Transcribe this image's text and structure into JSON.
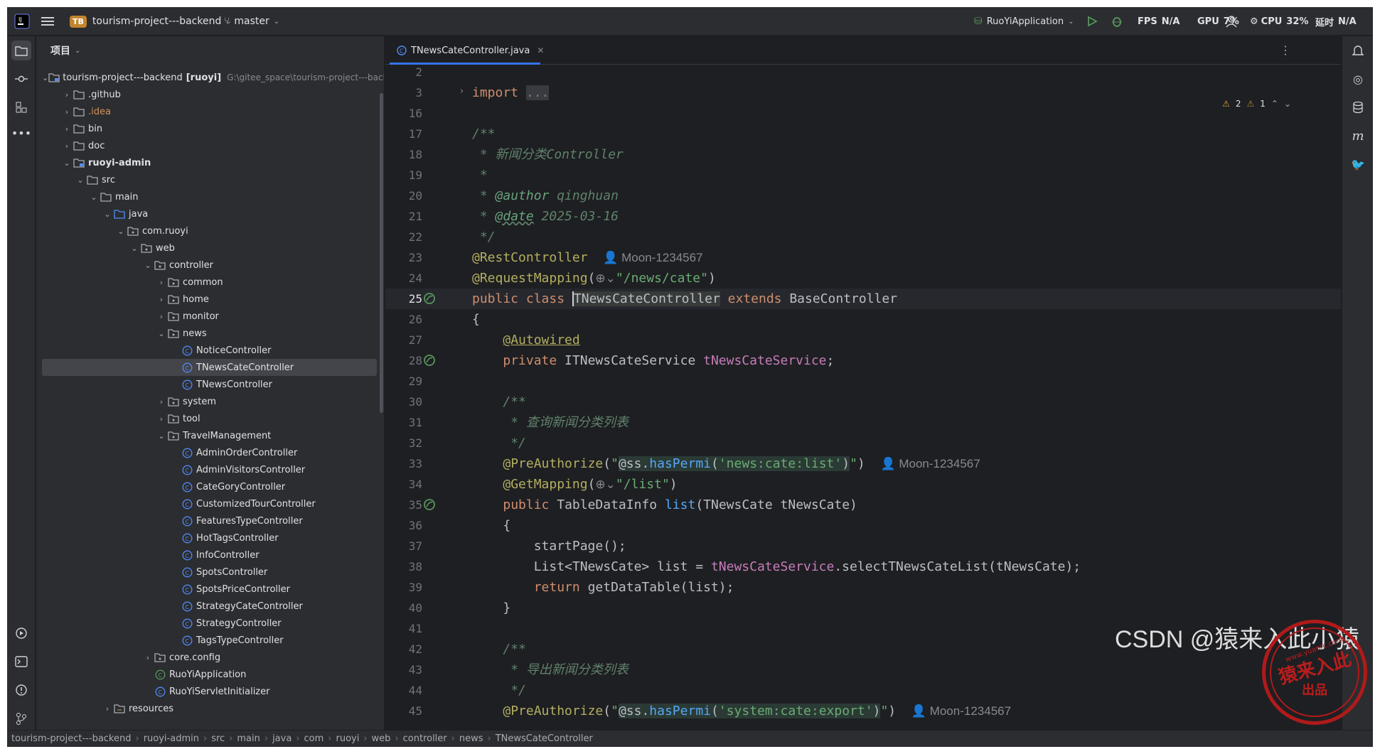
{
  "titlebar": {
    "project_badge": "TB",
    "project_name": "tourism-project---backend",
    "branch": "master",
    "run_config": "RuoYiApplication",
    "fps_label": "FPS",
    "fps_value": "N/A",
    "gpu_label": "GPU",
    "gpu_value": "7%",
    "cpu_label": "CPU",
    "cpu_value": "32%",
    "delay_label": "延时",
    "delay_value": "N/A"
  },
  "project_panel": {
    "title": "项目",
    "tree": [
      {
        "label": "tourism-project---backend",
        "suffix": "[ruoyi]",
        "path": "G:\\gitee_space\\tourism-project---back",
        "depth": 0,
        "open": true,
        "type": "module"
      },
      {
        "label": ".github",
        "depth": 1,
        "open": false,
        "type": "folder"
      },
      {
        "label": ".idea",
        "depth": 1,
        "open": false,
        "type": "folder",
        "color": "#d5935a"
      },
      {
        "label": "bin",
        "depth": 1,
        "open": false,
        "type": "folder"
      },
      {
        "label": "doc",
        "depth": 1,
        "open": false,
        "type": "folder"
      },
      {
        "label": "ruoyi-admin",
        "depth": 1,
        "open": true,
        "type": "module",
        "bold": true
      },
      {
        "label": "src",
        "depth": 2,
        "open": true,
        "type": "folder"
      },
      {
        "label": "main",
        "depth": 3,
        "open": true,
        "type": "folder"
      },
      {
        "label": "java",
        "depth": 4,
        "open": true,
        "type": "srcfolder"
      },
      {
        "label": "com.ruoyi",
        "depth": 5,
        "open": true,
        "type": "package"
      },
      {
        "label": "web",
        "depth": 6,
        "open": true,
        "type": "package"
      },
      {
        "label": "controller",
        "depth": 7,
        "open": true,
        "type": "package"
      },
      {
        "label": "common",
        "depth": 8,
        "open": false,
        "type": "package"
      },
      {
        "label": "home",
        "depth": 8,
        "open": false,
        "type": "package"
      },
      {
        "label": "monitor",
        "depth": 8,
        "open": false,
        "type": "package"
      },
      {
        "label": "news",
        "depth": 8,
        "open": true,
        "type": "package"
      },
      {
        "label": "NoticeController",
        "depth": 9,
        "type": "class"
      },
      {
        "label": "TNewsCateController",
        "depth": 9,
        "type": "class",
        "selected": true
      },
      {
        "label": "TNewsController",
        "depth": 9,
        "type": "class"
      },
      {
        "label": "system",
        "depth": 8,
        "open": false,
        "type": "package"
      },
      {
        "label": "tool",
        "depth": 8,
        "open": false,
        "type": "package"
      },
      {
        "label": "TravelManagement",
        "depth": 8,
        "open": true,
        "type": "package"
      },
      {
        "label": "AdminOrderController",
        "depth": 9,
        "type": "class"
      },
      {
        "label": "AdminVisitorsController",
        "depth": 9,
        "type": "class"
      },
      {
        "label": "CateGoryController",
        "depth": 9,
        "type": "class"
      },
      {
        "label": "CustomizedTourController",
        "depth": 9,
        "type": "class"
      },
      {
        "label": "FeaturesTypeController",
        "depth": 9,
        "type": "class"
      },
      {
        "label": "HotTagsController",
        "depth": 9,
        "type": "class"
      },
      {
        "label": "InfoController",
        "depth": 9,
        "type": "class"
      },
      {
        "label": "SpotsController",
        "depth": 9,
        "type": "class"
      },
      {
        "label": "SpotsPriceController",
        "depth": 9,
        "type": "class"
      },
      {
        "label": "StrategyCateController",
        "depth": 9,
        "type": "class"
      },
      {
        "label": "StrategyController",
        "depth": 9,
        "type": "class"
      },
      {
        "label": "TagsTypeController",
        "depth": 9,
        "type": "class"
      },
      {
        "label": "core.config",
        "depth": 7,
        "open": false,
        "type": "package"
      },
      {
        "label": "RuoYiApplication",
        "depth": 7,
        "type": "appclass"
      },
      {
        "label": "RuoYiServletInitializer",
        "depth": 7,
        "type": "class"
      },
      {
        "label": "resources",
        "depth": 4,
        "open": false,
        "type": "resfolder"
      }
    ]
  },
  "editor": {
    "tab_label": "TNewsCateController.java",
    "problems": {
      "warnings": "2",
      "weak": "1"
    },
    "lines": [
      {
        "n": "2",
        "html": ""
      },
      {
        "n": "3",
        "html": "<span class='kw'>import</span> <span style='background:#393b40;color:#7a7e85'>...</span>",
        "fold": true
      },
      {
        "n": "16",
        "html": ""
      },
      {
        "n": "17",
        "html": "<span class='dc'>/**</span>"
      },
      {
        "n": "18",
        "html": "<span class='dc'> * 新闻分类Controller</span>"
      },
      {
        "n": "19",
        "html": "<span class='dc'> *</span>"
      },
      {
        "n": "20",
        "html": "<span class='dc'> * </span><span class='dt'>@author</span><span class='dc'> qinghuan</span>"
      },
      {
        "n": "21",
        "html": "<span class='dc'> * </span><span class='dt' style='text-decoration:underline wavy #5f826b'>@date</span><span class='dc'> 2025-03-16</span>"
      },
      {
        "n": "22",
        "html": "<span class='dc'> */</span>"
      },
      {
        "n": "23",
        "html": "<span class='an'>@RestController</span>  <span class='inl'>👤 Moon-1234567</span>"
      },
      {
        "n": "24",
        "html": "<span class='an'>@RequestMapping</span>(<span class='inl'>⊕⌄</span><span class='st'>\"/news/cate\"</span>)"
      },
      {
        "n": "25",
        "html": "<span class='kw'>public class</span> <span style='border-left:2px solid #ced0d6;background:#373b39'>TNewsCateController</span> <span class='kw'>extends</span> BaseController",
        "current": true
      },
      {
        "n": "26",
        "html": "{"
      },
      {
        "n": "27",
        "html": "    <span class='an' style='text-decoration:underline #b3ae60'>@Autowired</span>"
      },
      {
        "n": "28",
        "html": "    <span class='kw'>private</span> ITNewsCateService <span class='fd'>tNewsCateService</span>;"
      },
      {
        "n": "29",
        "html": ""
      },
      {
        "n": "30",
        "html": "    <span class='dc'>/**</span>"
      },
      {
        "n": "31",
        "html": "    <span class='dc'> * 查询新闻分类列表</span>"
      },
      {
        "n": "32",
        "html": "    <span class='dc'> */</span>"
      },
      {
        "n": "33",
        "html": "    <span class='an'>@PreAuthorize</span>(<span class='st'>\"</span><span class='hlbox'>@ss.<span class='mt'>hasPermi</span>(<span class='st'>'news:cate:list'</span>)</span><span class='st'>\"</span>)  <span class='inl'>👤 Moon-1234567</span>"
      },
      {
        "n": "34",
        "html": "    <span class='an'>@GetMapping</span>(<span class='inl'>⊕⌄</span><span class='st'>\"/list\"</span>)"
      },
      {
        "n": "35",
        "html": "    <span class='kw'>public</span> TableDataInfo <span class='mt'>list</span>(TNewsCate tNewsCate)"
      },
      {
        "n": "36",
        "html": "    {"
      },
      {
        "n": "37",
        "html": "        startPage();"
      },
      {
        "n": "38",
        "html": "        List&lt;TNewsCate&gt; list = <span class='fd'>tNewsCateService</span>.selectTNewsCateList(tNewsCate);"
      },
      {
        "n": "39",
        "html": "        <span class='kw'>return</span> getDataTable(list);"
      },
      {
        "n": "40",
        "html": "    }"
      },
      {
        "n": "41",
        "html": ""
      },
      {
        "n": "42",
        "html": "    <span class='dc'>/**</span>"
      },
      {
        "n": "43",
        "html": "    <span class='dc'> * 导出新闻分类列表</span>"
      },
      {
        "n": "44",
        "html": "    <span class='dc'> */</span>"
      },
      {
        "n": "45",
        "html": "    <span class='an'>@PreAuthorize</span>(<span class='st'>\"</span><span class='hlbox'>@ss.<span class='mt'>hasPermi</span>(<span class='st'>'system:cate:export'</span>)</span><span class='st'>\"</span>)  <span class='inl'>👤 Moon-1234567</span>"
      }
    ]
  },
  "breadcrumbs": [
    "tourism-project---backend",
    "ruoyi-admin",
    "src",
    "main",
    "java",
    "com",
    "ruoyi",
    "web",
    "controller",
    "news",
    "TNewsCateController"
  ],
  "watermark": "CSDN @猿来入此小猿",
  "stamp": {
    "top": "www.yuanrc.com",
    "main": "猿来入此",
    "sub": "出品"
  }
}
